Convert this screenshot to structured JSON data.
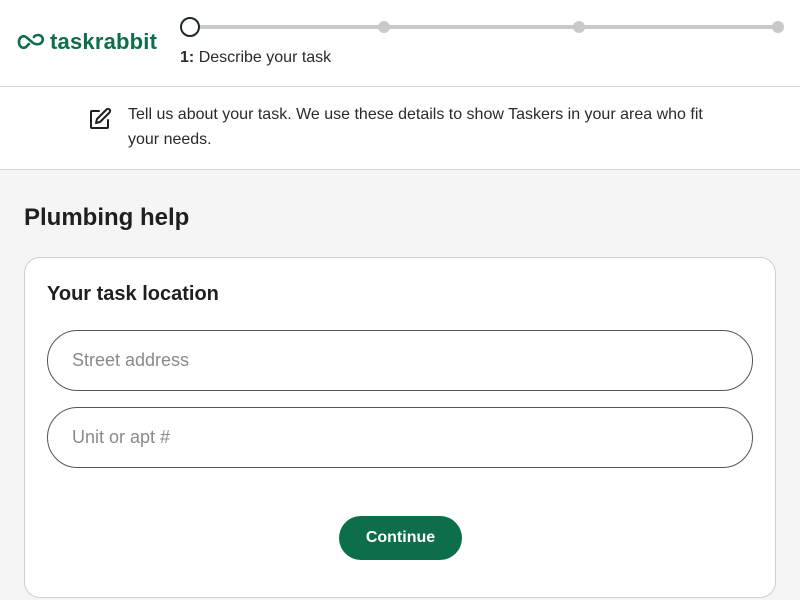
{
  "header": {
    "logo_text": "taskrabbit",
    "progress": {
      "current_step": 1,
      "total_steps": 4,
      "step_number": "1:",
      "step_label": "Describe your task"
    }
  },
  "info": {
    "icon": "edit-icon",
    "text": "Tell us about your task. We use these details to show Taskers in your area who fit your needs."
  },
  "main": {
    "title": "Plumbing help",
    "card": {
      "title": "Your task location",
      "street": {
        "value": "",
        "placeholder": "Street address"
      },
      "unit": {
        "value": "",
        "placeholder": "Unit or apt #"
      },
      "continue_label": "Continue"
    }
  },
  "colors": {
    "brand": "#0d6e4a",
    "background": "#f4f5f4",
    "track": "#c9c9c9"
  }
}
